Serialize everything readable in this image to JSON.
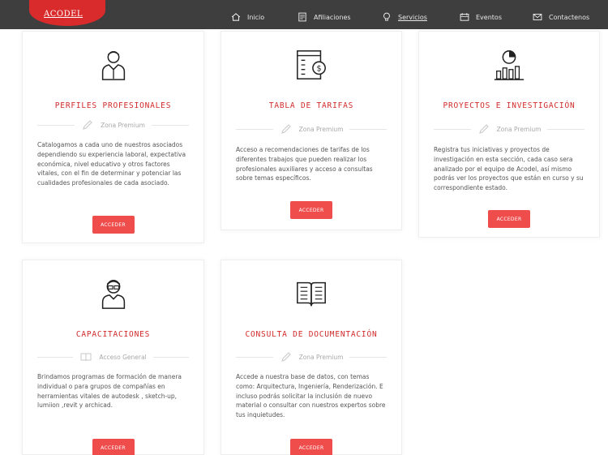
{
  "brand": {
    "logo_text": "ACODEL",
    "accent": "#d22a2a",
    "button_color": "#ef4c4c"
  },
  "nav": {
    "items": [
      {
        "label": "Inicio",
        "icon": "home-icon"
      },
      {
        "label": "Afiliaciones",
        "icon": "document-icon"
      },
      {
        "label": "Servicios",
        "icon": "idea-icon",
        "active": true
      },
      {
        "label": "Eventos",
        "icon": "calendar-icon"
      },
      {
        "label": "Contactenos",
        "icon": "mail-icon"
      }
    ]
  },
  "cards": [
    {
      "title": "PERFILES PROFESIONALES",
      "icon": "professional-person-icon",
      "zone_icon": "pencil-icon",
      "zone": "Zona Premium",
      "description": "Catalogamos a cada uno de nuestros asociados dependiendo su experiencia laboral, expectativa económica, nivel educativo y otros factores vitales, con el fin de determinar y potenciar las cualidades profesionales de cada asociado.",
      "button": "ACCEDER"
    },
    {
      "title": "TABLA DE TARIFAS",
      "icon": "price-list-icon",
      "zone_icon": "pencil-icon",
      "zone": "Zona Premium",
      "description": "Acceso a recomendaciones de tarifas de los diferentes trabajos que pueden realizar los profesionales auxiliares y acceso a consultas sobre temas específicos.",
      "button": "ACCEDER"
    },
    {
      "title": "PROYECTOS E INVESTIGACIÓN",
      "icon": "chart-research-icon",
      "zone_icon": "pencil-icon",
      "zone": "Zona Premium",
      "description": "Registra tus iniciativas y proyectos de investigación en esta sección, cada caso sera analizado por el equipo de Acodel, así mismo podrás ver los proyectos que están en curso y su correspondiente estado.",
      "button": "ACCEDER"
    },
    {
      "title": "CAPACITACIONES",
      "icon": "teacher-icon",
      "zone_icon": "open-book-icon",
      "zone": "Acceso General",
      "description": "Brindamos programas de formación de manera individual o para grupos de compañías en herramientas vitales de autodesk , sketch-up, lumiion ,revit y archicad.",
      "button": "ACCEDER"
    },
    {
      "title": "CONSULTA DE DOCUMENTACIÓN",
      "icon": "book-icon",
      "zone_icon": "pencil-icon",
      "zone": "Zona Premium",
      "description": "Accede a nuestra base de datos, con temas como: Arquitectura, Ingeniería, Renderización. E incluso podrás solicitar la inclusión de nuevo material o consultar con nuestros expertos sobre tus inquietudes.",
      "button": "ACCEDER"
    }
  ]
}
